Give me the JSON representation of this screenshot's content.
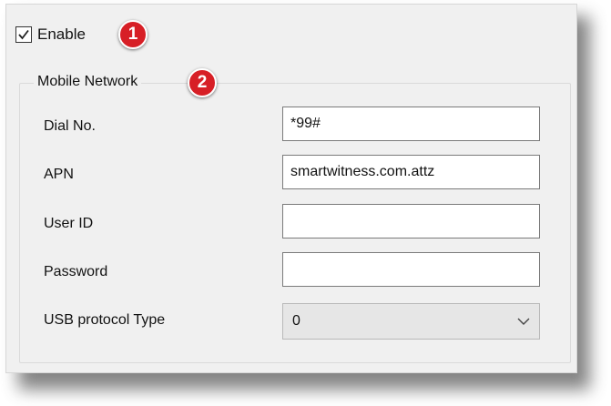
{
  "enable": {
    "label": "Enable",
    "checked": true,
    "badge": "1"
  },
  "mobile_network": {
    "title": "Mobile Network",
    "badge": "2",
    "fields": {
      "dial_no": {
        "label": "Dial No.",
        "value": "*99#"
      },
      "apn": {
        "label": "APN",
        "value": "smartwitness.com.attz"
      },
      "user_id": {
        "label": "User ID",
        "value": ""
      },
      "password": {
        "label": "Password",
        "value": ""
      },
      "usb_protocol_type": {
        "label": "USB protocol Type",
        "value": "0"
      }
    }
  },
  "colors": {
    "badge": "#d71f26",
    "panel_bg": "#f0f0f0",
    "select_bg": "#e6e6e6"
  },
  "icons": {
    "checkbox": "checkmark-icon",
    "select": "chevron-down-icon"
  }
}
